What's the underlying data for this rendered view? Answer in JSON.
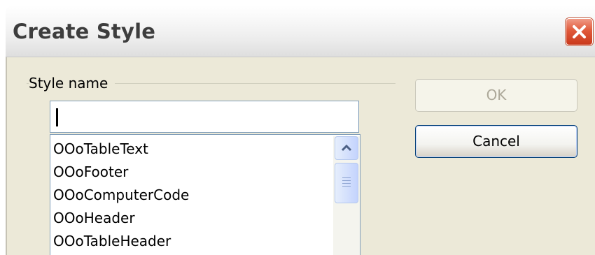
{
  "dialog": {
    "title": "Create Style",
    "close_icon": "close-x-icon"
  },
  "style_name": {
    "group_label": "Style name",
    "input_value": ""
  },
  "style_list": {
    "items": [
      "OOoTableText",
      "OOoFooter",
      "OOoComputerCode",
      "OOoHeader",
      "OOoTableHeader"
    ],
    "scroll_up_icon": "chevron-up-icon",
    "scroll_thumb_icon": "grip-icon"
  },
  "buttons": {
    "ok_label": "OK",
    "ok_enabled": false,
    "cancel_label": "Cancel"
  },
  "colors": {
    "close_button": "#e0593a",
    "field_border": "#7f9db9",
    "dialog_face": "#ece9d8"
  }
}
